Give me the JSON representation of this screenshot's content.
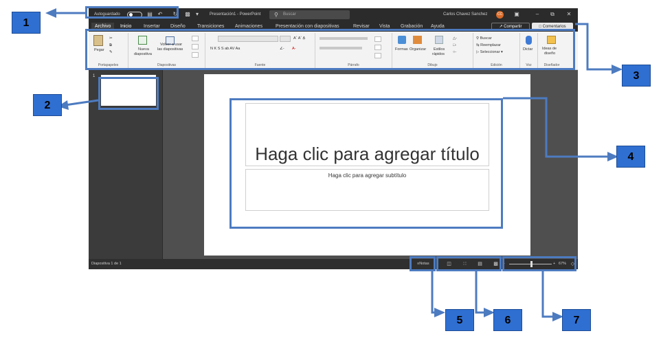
{
  "titlebar": {
    "autosave_label": "Autoguardado",
    "document_title": "Presentación1 - PowerPoint",
    "search_placeholder": "Buscar",
    "user_name": "Carlos Chavez Sanchez",
    "user_initials": "CC"
  },
  "menu": {
    "tabs": [
      "Archivo",
      "Inicio",
      "Insertar",
      "Diseño",
      "Transiciones",
      "Animaciones",
      "Presentación con diapositivas",
      "Revisar",
      "Vista",
      "Grabación",
      "Ayuda"
    ],
    "active_tab": "Inicio",
    "share_label": "Compartir",
    "comments_label": "Comentarios"
  },
  "ribbon": {
    "groups": [
      "Portapapeles",
      "Diapositivas",
      "Fuente",
      "Párrafo",
      "Dibujo",
      "Edición",
      "Voz",
      "Diseñador"
    ],
    "paste": "Pegar",
    "new_slide_1": "Nueva",
    "new_slide_2": "diapositiva",
    "reuse_1": "Volver a usar",
    "reuse_2": "las diapositivas",
    "font_buttons": "N  K  S  S  ab  AV  Aa",
    "shapes": "Formas",
    "arrange": "Organizar",
    "quick_styles_1": "Estilos",
    "quick_styles_2": "rápidos",
    "find": "Buscar",
    "replace": "Reemplazar",
    "select": "Seleccionar",
    "dictate": "Dictar",
    "design_ideas_1": "Ideas de",
    "design_ideas_2": "diseño"
  },
  "thumbnails": {
    "slide_number": "1"
  },
  "slide": {
    "title_placeholder": "Haga clic para agregar título",
    "subtitle_placeholder": "Haga clic para agregar subtítulo"
  },
  "statusbar": {
    "slide_info": "Diapositiva 1 de 1",
    "notes_label": "Notas",
    "zoom_minus": "-",
    "zoom_plus": "+",
    "zoom_percent": "67%"
  },
  "callouts": [
    "1",
    "2",
    "3",
    "4",
    "5",
    "6",
    "7"
  ],
  "colors": {
    "highlight": "#4d7bc0",
    "callout_fill": "#2f6fd1",
    "accent": "#e2774a"
  }
}
